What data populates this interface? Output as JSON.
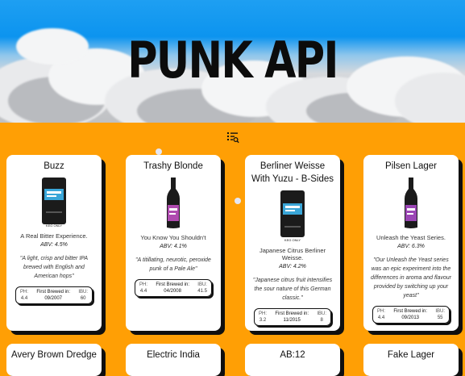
{
  "header": {
    "title": "PUNK API"
  },
  "colors": {
    "page_bg": "#ff9f05",
    "card_bg": "#ffffff",
    "shadow": "#0f0f0f"
  },
  "toolbar": {
    "menu_icon": "list-search-icon"
  },
  "labels": {
    "ph": "PH:",
    "first_brewed": "First Brewed in:",
    "ibu": "IBU:"
  },
  "beers": [
    {
      "name": "Buzz",
      "bottle": "can",
      "tagline": "A Real Bitter Experience.",
      "abv": "ABV: 4.5%",
      "description": "\"A light, crisp and bitter IPA brewed with English and American hops\"",
      "ph": "4.4",
      "first_brewed": "09/2007",
      "ibu": "60"
    },
    {
      "name": "Trashy Blonde",
      "bottle": "bottle",
      "tagline": "You Know You Shouldn't",
      "abv": "ABV: 4.1%",
      "description": "\"A titillating, neurotic, peroxide punk of a Pale Ale\"",
      "ph": "4.4",
      "first_brewed": "04/2008",
      "ibu": "41.5"
    },
    {
      "name": "Berliner Weisse With Yuzu - B-Sides",
      "bottle": "can",
      "tagline": "Japanese Citrus Berliner Weisse.",
      "abv": "ABV: 4.2%",
      "description": "\"Japanese citrus fruit intensifies the sour nature of this German classic.\"",
      "ph": "3.2",
      "first_brewed": "11/2015",
      "ibu": "8"
    },
    {
      "name": "Pilsen Lager",
      "bottle": "bottle",
      "tagline": "Unleash the Yeast Series.",
      "abv": "ABV: 6.3%",
      "description": "\"Our Unleash the Yeast series was an epic experiment into the differences in aroma and flavour provided by switching up your yeast\"",
      "ph": "4.4",
      "first_brewed": "09/2013",
      "ibu": "55"
    },
    {
      "name": "Avery Brown Dredge"
    },
    {
      "name": "Electric India"
    },
    {
      "name": "AB:12"
    },
    {
      "name": "Fake Lager"
    }
  ],
  "can_label": "KEG ONLY"
}
